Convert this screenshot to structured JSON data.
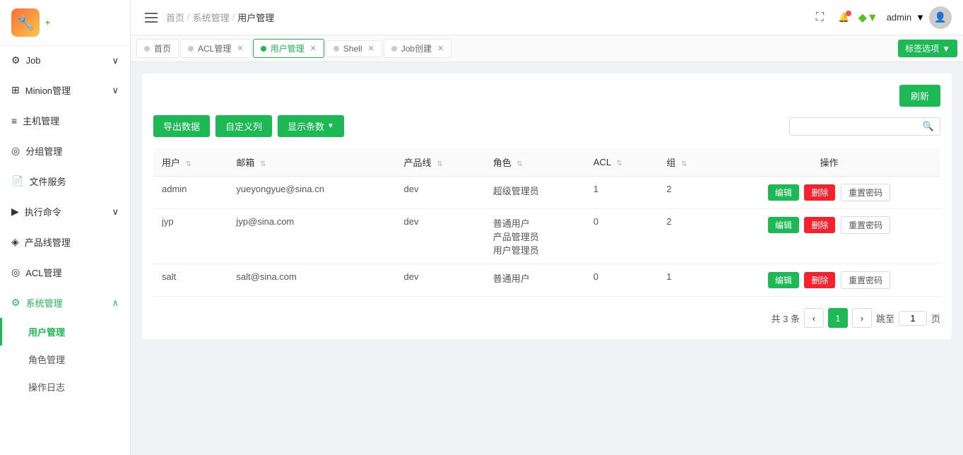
{
  "logo": {
    "icon": "🔧",
    "plus": "+"
  },
  "sidebar": {
    "items": [
      {
        "id": "job",
        "icon": "⚙",
        "label": "Job",
        "hasArrow": true,
        "expanded": false
      },
      {
        "id": "minion",
        "icon": "⊞",
        "label": "Minion管理",
        "hasArrow": true,
        "expanded": false
      },
      {
        "id": "host",
        "icon": "≡",
        "label": "主机管理",
        "hasArrow": false
      },
      {
        "id": "group",
        "icon": "◎",
        "label": "分组管理",
        "hasArrow": false
      },
      {
        "id": "file",
        "icon": "📄",
        "label": "文件服务",
        "hasArrow": false
      },
      {
        "id": "exec",
        "icon": "▶",
        "label": "执行命令",
        "hasArrow": true,
        "expanded": false
      },
      {
        "id": "product",
        "icon": "◈",
        "label": "产品线管理",
        "hasArrow": false
      },
      {
        "id": "acl",
        "icon": "◎",
        "label": "ACL管理",
        "hasArrow": false
      },
      {
        "id": "system",
        "icon": "⚙",
        "label": "系统管理",
        "hasArrow": true,
        "expanded": true
      }
    ],
    "submenu_system": [
      {
        "id": "user-mgmt",
        "label": "用户管理",
        "active": true
      },
      {
        "id": "role-mgmt",
        "label": "角色管理",
        "active": false
      },
      {
        "id": "op-log",
        "label": "操作日志",
        "active": false
      }
    ]
  },
  "header": {
    "breadcrumbs": [
      {
        "label": "首页",
        "active": false
      },
      {
        "label": "系统管理",
        "active": false
      },
      {
        "label": "用户管理",
        "active": true
      }
    ],
    "user": "admin",
    "fullscreen_title": "全屏"
  },
  "tabs": [
    {
      "id": "home",
      "label": "首页",
      "dot_color": "gray",
      "closable": false
    },
    {
      "id": "acl",
      "label": "ACL管理",
      "dot_color": "gray",
      "closable": true
    },
    {
      "id": "user-mgmt",
      "label": "用户管理",
      "dot_color": "green",
      "closable": true,
      "active": true
    },
    {
      "id": "shell",
      "label": "Shell",
      "dot_color": "gray",
      "closable": true
    },
    {
      "id": "job-create",
      "label": "Job创建",
      "dot_color": "gray",
      "closable": true
    }
  ],
  "tabs_action": {
    "label": "标签选项",
    "icon": "▼"
  },
  "toolbar": {
    "export_label": "导出数据",
    "customize_label": "自定义列",
    "display_label": "显示条数",
    "refresh_label": "刷新",
    "search_placeholder": ""
  },
  "table": {
    "columns": [
      {
        "key": "user",
        "label": "用户"
      },
      {
        "key": "email",
        "label": "邮箱"
      },
      {
        "key": "product_line",
        "label": "产品线"
      },
      {
        "key": "role",
        "label": "角色"
      },
      {
        "key": "acl",
        "label": "ACL"
      },
      {
        "key": "group",
        "label": "组"
      },
      {
        "key": "actions",
        "label": "操作"
      }
    ],
    "rows": [
      {
        "user": "admin",
        "email": "yueyongyue@sina.cn",
        "product_line": "dev",
        "role": "超级管理员",
        "acl": "1",
        "group": "2",
        "actions": {
          "edit": "编辑",
          "delete": "删除",
          "reset": "重置密码"
        }
      },
      {
        "user": "jyp",
        "email": "jyp@sina.com",
        "product_line": "dev",
        "role": "普通用户\n产品管理员\n用户管理员",
        "acl": "0",
        "group": "2",
        "actions": {
          "edit": "编辑",
          "delete": "删除",
          "reset": "重置密码"
        }
      },
      {
        "user": "salt",
        "email": "salt@sina.com",
        "product_line": "dev",
        "role": "普通用户",
        "acl": "0",
        "group": "1",
        "actions": {
          "edit": "编辑",
          "delete": "删除",
          "reset": "重置密码"
        }
      }
    ]
  },
  "pagination": {
    "total_text": "共 3 条",
    "current_page": 1,
    "jump_label": "跳至",
    "page_label": "页"
  }
}
